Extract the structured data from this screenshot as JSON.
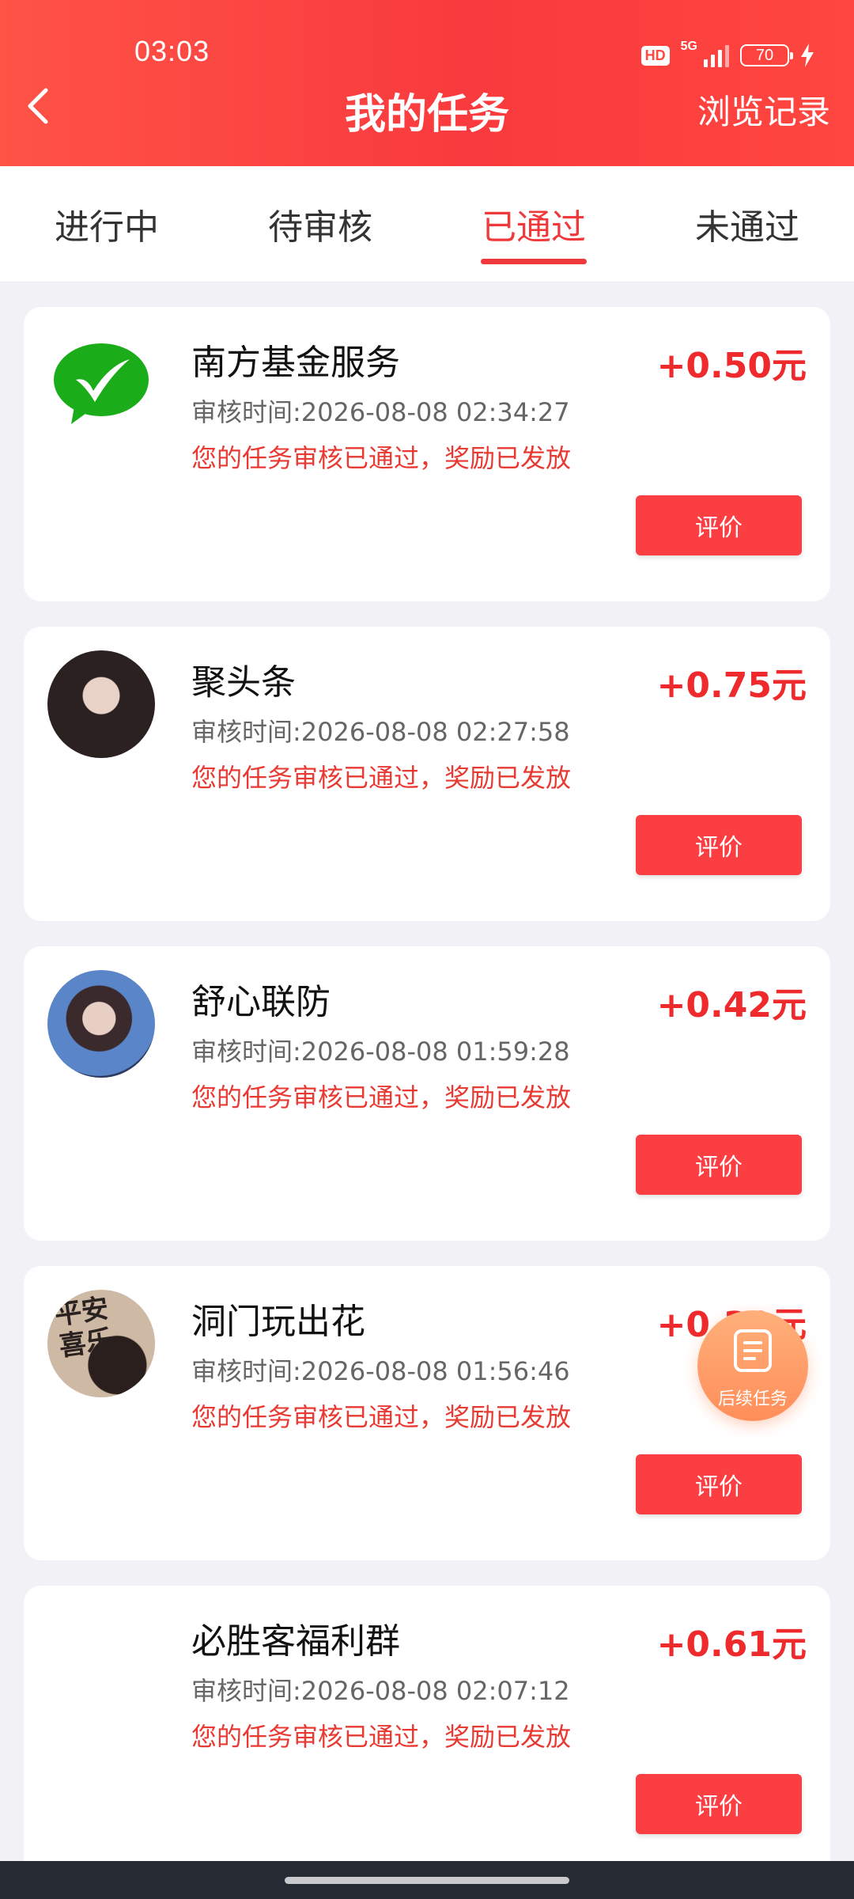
{
  "status_bar": {
    "time": "03:03",
    "hd": "HD",
    "network": "5G",
    "battery": "70"
  },
  "header": {
    "title": "我的任务",
    "history": "浏览记录"
  },
  "tabs": [
    {
      "label": "进行中"
    },
    {
      "label": "待审核"
    },
    {
      "label": "已通过"
    },
    {
      "label": "未通过"
    }
  ],
  "active_tab": "已通过",
  "tasks": [
    {
      "title": "南方基金服务",
      "reward": "+0.50元",
      "review_time": "审核时间:2026-08-08 02:34:27",
      "status": "您的任务审核已通过，奖励已发放",
      "button": "评价",
      "avatar": "wechat-logo"
    },
    {
      "title": "聚头条",
      "reward": "+0.75元",
      "review_time": "审核时间:2026-08-08 02:27:58",
      "status": "您的任务审核已通过，奖励已发放",
      "button": "评价",
      "avatar": "user-avatar"
    },
    {
      "title": "舒心联防",
      "reward": "+0.42元",
      "review_time": "审核时间:2026-08-08 01:59:28",
      "status": "您的任务审核已通过，奖励已发放",
      "button": "评价",
      "avatar": "user-avatar"
    },
    {
      "title": "洞门玩出花",
      "reward": "+0.30元",
      "review_time": "审核时间:2026-08-08 01:56:46",
      "status": "您的任务审核已通过，奖励已发放",
      "button": "评价",
      "avatar": "user-avatar",
      "avatar_text": "平安\n喜乐"
    },
    {
      "title": "必胜客福利群",
      "reward": "+0.61元",
      "review_time": "审核时间:2026-08-08 02:07:12",
      "status": "您的任务审核已通过，奖励已发放",
      "button": "评价",
      "avatar": "blank"
    }
  ],
  "float_button": {
    "label": "后续任务",
    "icon": "list-document-icon"
  },
  "colors": {
    "header": "#f93a3e",
    "accent": "#ee2a2c",
    "button": "#fb3e42",
    "float": "#ff9a64"
  }
}
